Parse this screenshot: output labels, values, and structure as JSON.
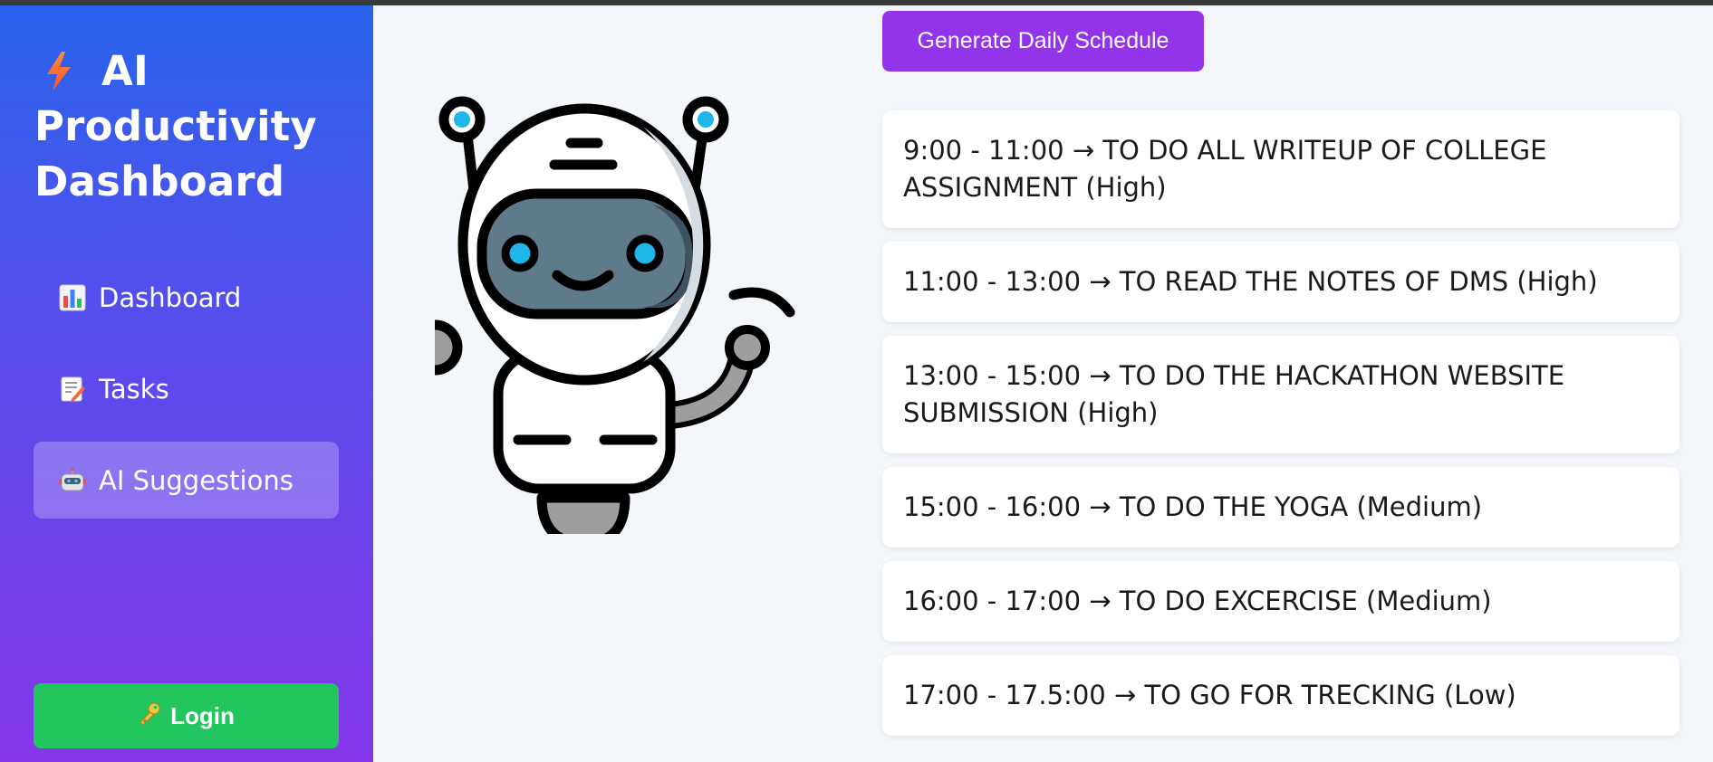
{
  "sidebar": {
    "brand_lines": [
      "AI",
      "Productivity",
      "Dashboard"
    ],
    "items": [
      {
        "icon": "bar-chart-icon",
        "label": "Dashboard",
        "active": false
      },
      {
        "icon": "memo-icon",
        "label": "Tasks",
        "active": false
      },
      {
        "icon": "robot-icon",
        "label": "AI Suggestions",
        "active": true
      }
    ],
    "login_label": "Login",
    "login_icon": "key-icon"
  },
  "main": {
    "generate_label": "Generate Daily Schedule",
    "schedule": [
      "9:00 - 11:00 → TO DO ALL WRITEUP OF COLLEGE ASSIGNMENT (High)",
      "11:00 - 13:00 → TO READ THE NOTES OF DMS (High)",
      "13:00 - 15:00 → TO DO THE HACKATHON WEBSITE SUBMISSION (High)",
      "15:00 - 16:00 → TO DO THE YOGA (Medium)",
      "16:00 - 17:00 → TO DO EXCERCISE (Medium)",
      "17:00 - 17.5:00 → TO GO FOR TRECKING (Low)"
    ]
  },
  "colors": {
    "sidebar_top": "#2863eb",
    "sidebar_bottom": "#8437e8",
    "login": "#22c55e",
    "generate": "#9333ea",
    "background": "#f3f6fb"
  }
}
